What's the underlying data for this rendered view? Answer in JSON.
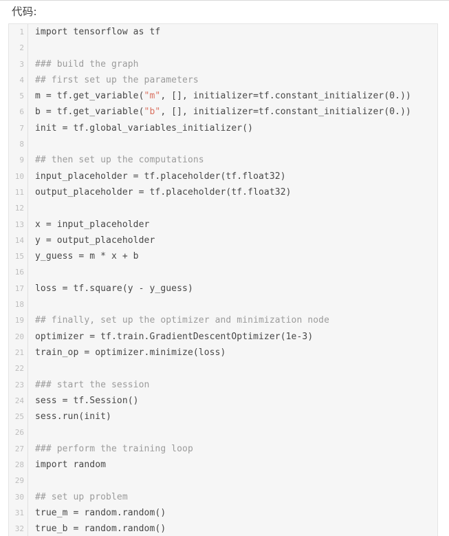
{
  "page": {
    "title": "代码:"
  },
  "colors": {
    "page_background": "#ffffff",
    "code_background": "#f6f6f6",
    "code_border": "#e4e4e4",
    "title_text": "#3d3d3d",
    "line_number_text": "#bdbdbd",
    "code_text": "#464646",
    "comment_text": "#9b9b9b",
    "string_text": "#d9705f",
    "gutter_divider": "#e0e0e0",
    "top_rule": "#d8d8d8"
  },
  "code_block": {
    "language": "python",
    "first_line_number": 1,
    "last_visible_line_number": 32,
    "lines": [
      {
        "n": 1,
        "tokens": [
          {
            "t": "code",
            "v": "import tensorflow as tf"
          }
        ]
      },
      {
        "n": 2,
        "tokens": []
      },
      {
        "n": 3,
        "tokens": [
          {
            "t": "comment",
            "v": "### build the graph"
          }
        ]
      },
      {
        "n": 4,
        "tokens": [
          {
            "t": "comment",
            "v": "## first set up the parameters"
          }
        ]
      },
      {
        "n": 5,
        "tokens": [
          {
            "t": "code",
            "v": "m = tf.get_variable("
          },
          {
            "t": "string",
            "v": "\"m\""
          },
          {
            "t": "code",
            "v": ", [], initializer=tf.constant_initializer(0.))"
          }
        ]
      },
      {
        "n": 6,
        "tokens": [
          {
            "t": "code",
            "v": "b = tf.get_variable("
          },
          {
            "t": "string",
            "v": "\"b\""
          },
          {
            "t": "code",
            "v": ", [], initializer=tf.constant_initializer(0.))"
          }
        ]
      },
      {
        "n": 7,
        "tokens": [
          {
            "t": "code",
            "v": "init = tf.global_variables_initializer()"
          }
        ]
      },
      {
        "n": 8,
        "tokens": []
      },
      {
        "n": 9,
        "tokens": [
          {
            "t": "comment",
            "v": "## then set up the computations"
          }
        ]
      },
      {
        "n": 10,
        "tokens": [
          {
            "t": "code",
            "v": "input_placeholder = tf.placeholder(tf.float32)"
          }
        ]
      },
      {
        "n": 11,
        "tokens": [
          {
            "t": "code",
            "v": "output_placeholder = tf.placeholder(tf.float32)"
          }
        ]
      },
      {
        "n": 12,
        "tokens": []
      },
      {
        "n": 13,
        "tokens": [
          {
            "t": "code",
            "v": "x = input_placeholder"
          }
        ]
      },
      {
        "n": 14,
        "tokens": [
          {
            "t": "code",
            "v": "y = output_placeholder"
          }
        ]
      },
      {
        "n": 15,
        "tokens": [
          {
            "t": "code",
            "v": "y_guess = m * x + b"
          }
        ]
      },
      {
        "n": 16,
        "tokens": []
      },
      {
        "n": 17,
        "tokens": [
          {
            "t": "code",
            "v": "loss = tf.square(y - y_guess)"
          }
        ]
      },
      {
        "n": 18,
        "tokens": []
      },
      {
        "n": 19,
        "tokens": [
          {
            "t": "comment",
            "v": "## finally, set up the optimizer and minimization node"
          }
        ]
      },
      {
        "n": 20,
        "tokens": [
          {
            "t": "code",
            "v": "optimizer = tf.train.GradientDescentOptimizer(1e-3)"
          }
        ]
      },
      {
        "n": 21,
        "tokens": [
          {
            "t": "code",
            "v": "train_op = optimizer.minimize(loss)"
          }
        ]
      },
      {
        "n": 22,
        "tokens": []
      },
      {
        "n": 23,
        "tokens": [
          {
            "t": "comment",
            "v": "### start the session"
          }
        ]
      },
      {
        "n": 24,
        "tokens": [
          {
            "t": "code",
            "v": "sess = tf.Session()"
          }
        ]
      },
      {
        "n": 25,
        "tokens": [
          {
            "t": "code",
            "v": "sess.run(init)"
          }
        ]
      },
      {
        "n": 26,
        "tokens": []
      },
      {
        "n": 27,
        "tokens": [
          {
            "t": "comment",
            "v": "### perform the training loop"
          }
        ]
      },
      {
        "n": 28,
        "tokens": [
          {
            "t": "code",
            "v": "import random"
          }
        ]
      },
      {
        "n": 29,
        "tokens": []
      },
      {
        "n": 30,
        "tokens": [
          {
            "t": "comment",
            "v": "## set up problem"
          }
        ]
      },
      {
        "n": 31,
        "tokens": [
          {
            "t": "code",
            "v": "true_m = random.random()"
          }
        ]
      },
      {
        "n": 32,
        "tokens": [
          {
            "t": "code",
            "v": "true_b = random.random()"
          }
        ]
      }
    ]
  }
}
